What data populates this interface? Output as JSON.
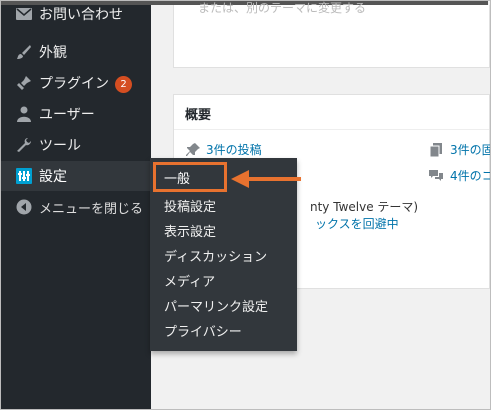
{
  "sidebar": {
    "items": [
      {
        "label": "お問い合わせ",
        "icon": "mail-icon"
      },
      {
        "label": "外観",
        "icon": "paintbrush-icon"
      },
      {
        "label": "プラグイン",
        "icon": "plugin-icon",
        "badge": "2"
      },
      {
        "label": "ユーザー",
        "icon": "user-icon"
      },
      {
        "label": "ツール",
        "icon": "wrench-icon"
      },
      {
        "label": "設定",
        "icon": "settings-icon"
      },
      {
        "label": "メニューを閉じる",
        "icon": "collapse-icon"
      }
    ]
  },
  "submenu": {
    "items": [
      "一般",
      "投稿設定",
      "表示設定",
      "ディスカッション",
      "メディア",
      "パーマリンク設定",
      "プライバシー"
    ]
  },
  "top_panel": {
    "text": "または、別のテーマに変更する"
  },
  "glance": {
    "title": "概要",
    "posts": "3件の投稿",
    "pages": "3件の固",
    "comments": "4件のコ",
    "theme_fragment": "nty Twelve テーマ)",
    "search_fragment": "ックスを回避中"
  },
  "colors": {
    "highlight": "#e8722f",
    "sidebar": "#23282d",
    "link": "#0073aa",
    "badge": "#d54e21"
  }
}
